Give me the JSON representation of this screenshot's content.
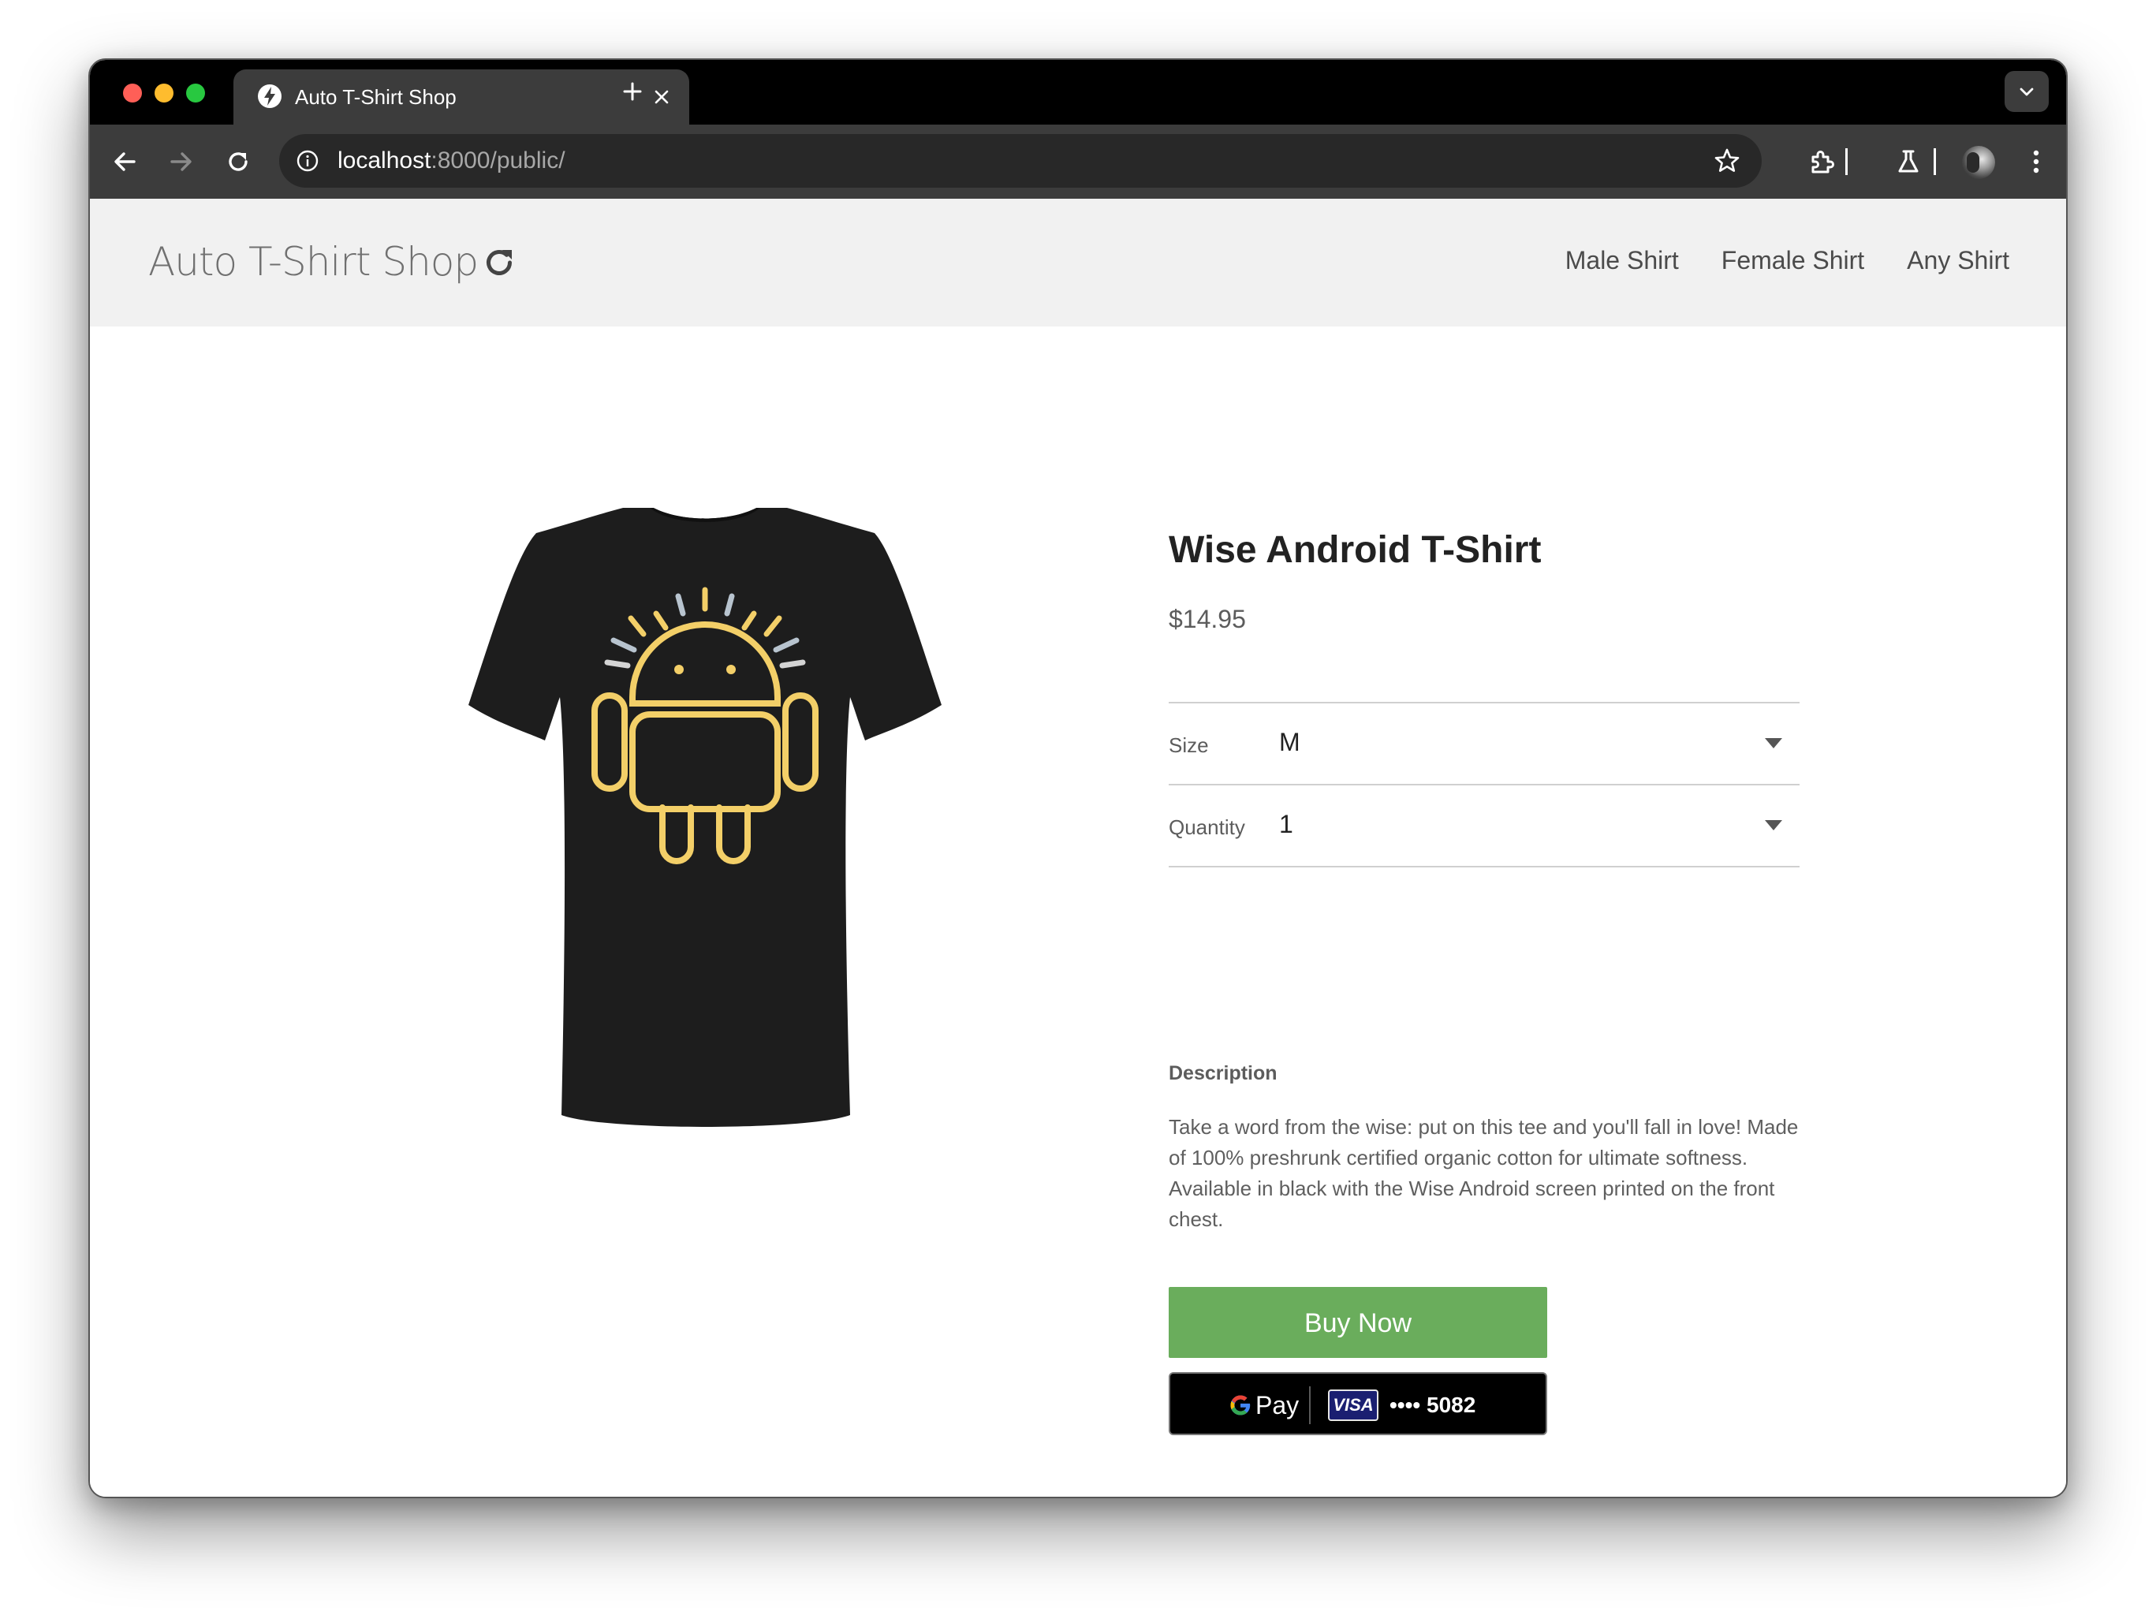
{
  "browser": {
    "tab": {
      "title": "Auto T-Shirt Shop"
    },
    "address": {
      "host": "localhost",
      "path": ":8000/public/"
    }
  },
  "site": {
    "title": "Auto T-Shirt Shop",
    "nav": [
      "Male Shirt",
      "Female Shirt",
      "Any Shirt"
    ]
  },
  "product": {
    "name": "Wise Android T-Shirt",
    "price": "$14.95",
    "size": {
      "label": "Size",
      "value": "M"
    },
    "quantity": {
      "label": "Quantity",
      "value": "1"
    },
    "description_heading": "Description",
    "description": "Take a word from the wise: put on this tee and you'll fall in love! Made of 100% preshrunk certified organic cotton for ultimate softness. Available in black with the Wise Android screen printed on the front chest.",
    "image_icon": "black-tshirt-with-android-print"
  },
  "actions": {
    "buy_now": "Buy Now",
    "gpay": {
      "pay": "Pay",
      "card_brand": "VISA",
      "card_masked": "•••• 5082"
    }
  },
  "colors": {
    "buy_button": "#6aad5c",
    "header_bg": "#f1f1f1",
    "print_yellow": "#f3cf68"
  }
}
